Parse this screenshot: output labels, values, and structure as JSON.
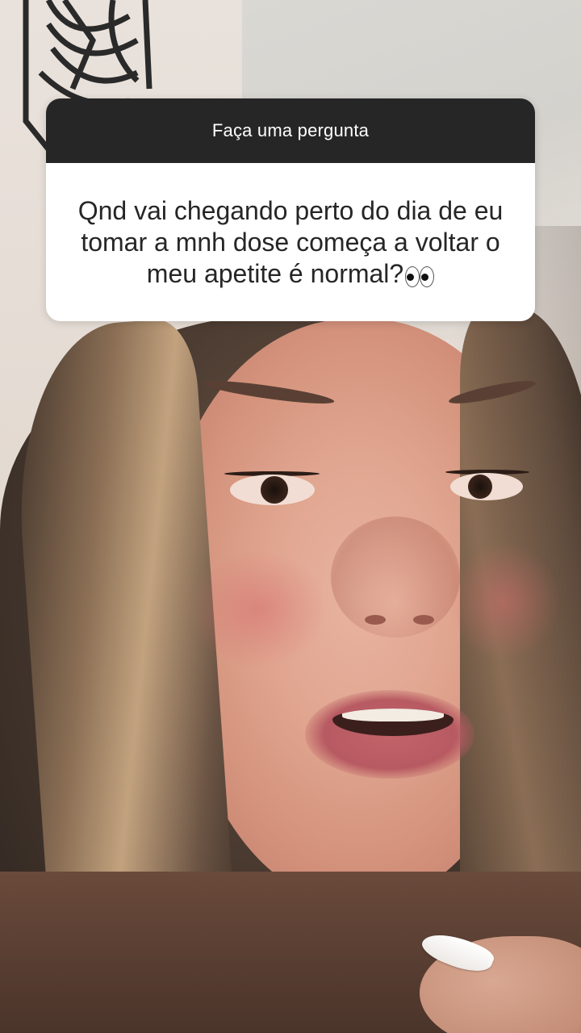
{
  "question_sticker": {
    "header": "Faça uma pergunta",
    "question": "Qnd vai chegando perto do dia de eu tomar a mnh dose começa a voltar o meu apetite é normal?",
    "emoji_icon": "eyes-emoji"
  },
  "colors": {
    "header_bg": "#262626",
    "card_bg": "#ffffff",
    "text": "#262626"
  }
}
